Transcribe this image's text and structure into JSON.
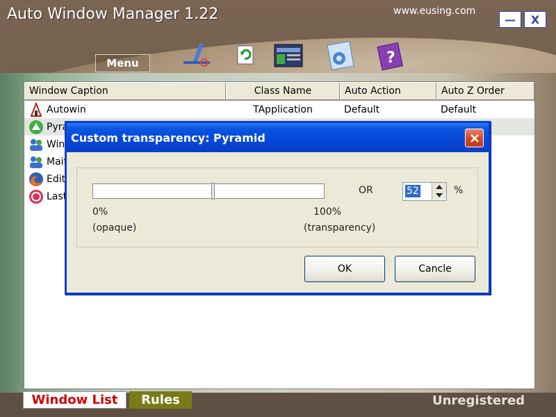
{
  "app": {
    "title": "Auto Window Manager 1.22",
    "website": "www.eusing.com",
    "minimize_label": "—",
    "close_label": "X",
    "menu_label": "Menu",
    "toolbar_icons": [
      "pen-icon",
      "refresh-icon",
      "window-list-icon",
      "gear-icon",
      "help-book-icon"
    ]
  },
  "list": {
    "columns": [
      "Window Caption",
      "Class Name",
      "Auto Action",
      "Auto Z Order"
    ],
    "rows": [
      {
        "caption": "Autowin",
        "class": "TApplication",
        "action": "Default",
        "zorder": "Default",
        "icon": "autowin-icon"
      },
      {
        "caption": "Pyra",
        "class": "",
        "action": "",
        "zorder": "",
        "icon": "pyramid-icon"
      },
      {
        "caption": "Wind",
        "class": "",
        "action": "",
        "zorder": "",
        "icon": "users-icon"
      },
      {
        "caption": "Maite",
        "class": "",
        "action": "",
        "zorder": "",
        "icon": "users-icon"
      },
      {
        "caption": "Edito",
        "class": "",
        "action": "",
        "zorder": "",
        "icon": "firefox-icon"
      },
      {
        "caption": "Last",
        "class": "",
        "action": "",
        "zorder": "",
        "icon": "last-icon"
      }
    ]
  },
  "tabs": [
    "Window List",
    "Rules"
  ],
  "status": "Unregistered",
  "dialog": {
    "title": "Custom transparency: Pyramid",
    "min_label": "0%",
    "min_sub": "(opaque)",
    "max_label": "100%",
    "max_sub": "(transparency)",
    "or_label": "OR",
    "percent_value": "52",
    "percent_sign": "%",
    "ok_label": "OK",
    "cancel_label": "Cancle",
    "slider_value_percent": 52
  },
  "colors": {
    "title_bar": "#0547d8",
    "tab_active_text": "#d20000",
    "tab_rules_bg": "#7a7a16"
  }
}
